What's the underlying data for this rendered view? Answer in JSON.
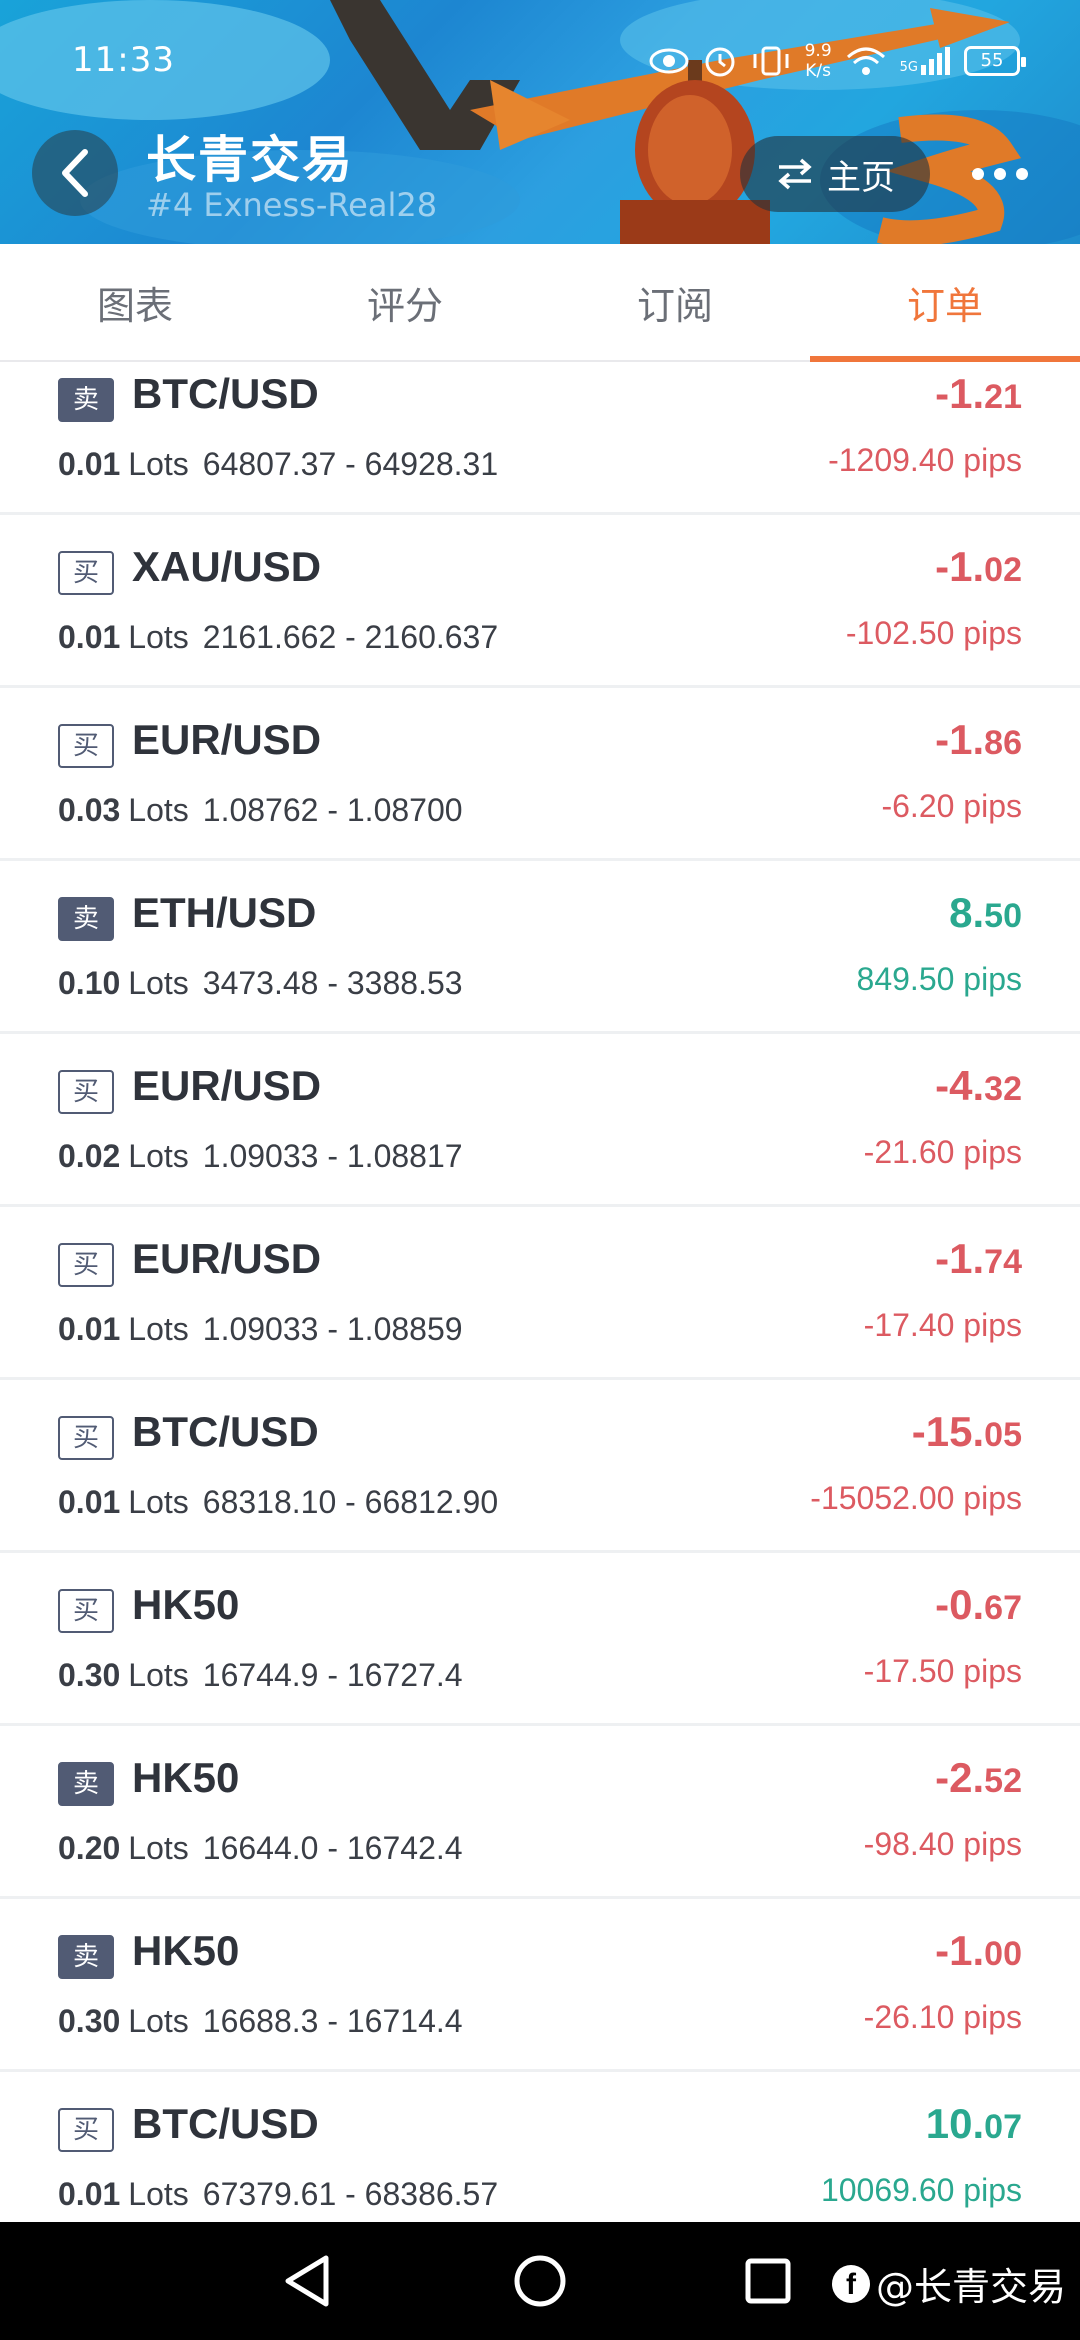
{
  "status_bar": {
    "time": "11:33",
    "speed_value": "9.9",
    "speed_unit": "K/s",
    "network": "5G",
    "battery": "55"
  },
  "header": {
    "title": "长青交易",
    "subtitle": "#4   Exness-Real28",
    "home_label": "主页"
  },
  "tabs": [
    {
      "label": "图表",
      "active": false
    },
    {
      "label": "评分",
      "active": false
    },
    {
      "label": "订阅",
      "active": false
    },
    {
      "label": "订单",
      "active": true
    }
  ],
  "orders": [
    {
      "side": "卖",
      "side_type": "sell",
      "symbol": "BTC/USD",
      "lots": "0.01",
      "lots_label": "Lots",
      "prices": "64807.37 - 64928.31",
      "profit_int": "-1.",
      "profit_dec": "21",
      "pips": "-1209.40 pips",
      "sign": "neg"
    },
    {
      "side": "买",
      "side_type": "buy",
      "symbol": "XAU/USD",
      "lots": "0.01",
      "lots_label": "Lots",
      "prices": "2161.662 - 2160.637",
      "profit_int": "-1.",
      "profit_dec": "02",
      "pips": "-102.50 pips",
      "sign": "neg"
    },
    {
      "side": "买",
      "side_type": "buy",
      "symbol": "EUR/USD",
      "lots": "0.03",
      "lots_label": "Lots",
      "prices": "1.08762 - 1.08700",
      "profit_int": "-1.",
      "profit_dec": "86",
      "pips": "-6.20 pips",
      "sign": "neg"
    },
    {
      "side": "卖",
      "side_type": "sell",
      "symbol": "ETH/USD",
      "lots": "0.10",
      "lots_label": "Lots",
      "prices": "3473.48 - 3388.53",
      "profit_int": "8.",
      "profit_dec": "50",
      "pips": "849.50 pips",
      "sign": "pos"
    },
    {
      "side": "买",
      "side_type": "buy",
      "symbol": "EUR/USD",
      "lots": "0.02",
      "lots_label": "Lots",
      "prices": "1.09033 - 1.08817",
      "profit_int": "-4.",
      "profit_dec": "32",
      "pips": "-21.60 pips",
      "sign": "neg"
    },
    {
      "side": "买",
      "side_type": "buy",
      "symbol": "EUR/USD",
      "lots": "0.01",
      "lots_label": "Lots",
      "prices": "1.09033 - 1.08859",
      "profit_int": "-1.",
      "profit_dec": "74",
      "pips": "-17.40 pips",
      "sign": "neg"
    },
    {
      "side": "买",
      "side_type": "buy",
      "symbol": "BTC/USD",
      "lots": "0.01",
      "lots_label": "Lots",
      "prices": "68318.10 - 66812.90",
      "profit_int": "-15.",
      "profit_dec": "05",
      "pips": "-15052.00 pips",
      "sign": "neg"
    },
    {
      "side": "买",
      "side_type": "buy",
      "symbol": "HK50",
      "lots": "0.30",
      "lots_label": "Lots",
      "prices": "16744.9 - 16727.4",
      "profit_int": "-0.",
      "profit_dec": "67",
      "pips": "-17.50 pips",
      "sign": "neg"
    },
    {
      "side": "卖",
      "side_type": "sell",
      "symbol": "HK50",
      "lots": "0.20",
      "lots_label": "Lots",
      "prices": "16644.0 - 16742.4",
      "profit_int": "-2.",
      "profit_dec": "52",
      "pips": "-98.40 pips",
      "sign": "neg"
    },
    {
      "side": "卖",
      "side_type": "sell",
      "symbol": "HK50",
      "lots": "0.30",
      "lots_label": "Lots",
      "prices": "16688.3 - 16714.4",
      "profit_int": "-1.",
      "profit_dec": "00",
      "pips": "-26.10 pips",
      "sign": "neg"
    },
    {
      "side": "买",
      "side_type": "buy",
      "symbol": "BTC/USD",
      "lots": "0.01",
      "lots_label": "Lots",
      "prices": "67379.61 - 68386.57",
      "profit_int": "10.",
      "profit_dec": "07",
      "pips": "10069.60 pips",
      "sign": "pos"
    }
  ],
  "watermark": {
    "text": "@长青交易"
  },
  "colors": {
    "accent": "#f0763b",
    "negative": "#dc5a61",
    "positive": "#2aa88f",
    "badge": "#515b74"
  }
}
